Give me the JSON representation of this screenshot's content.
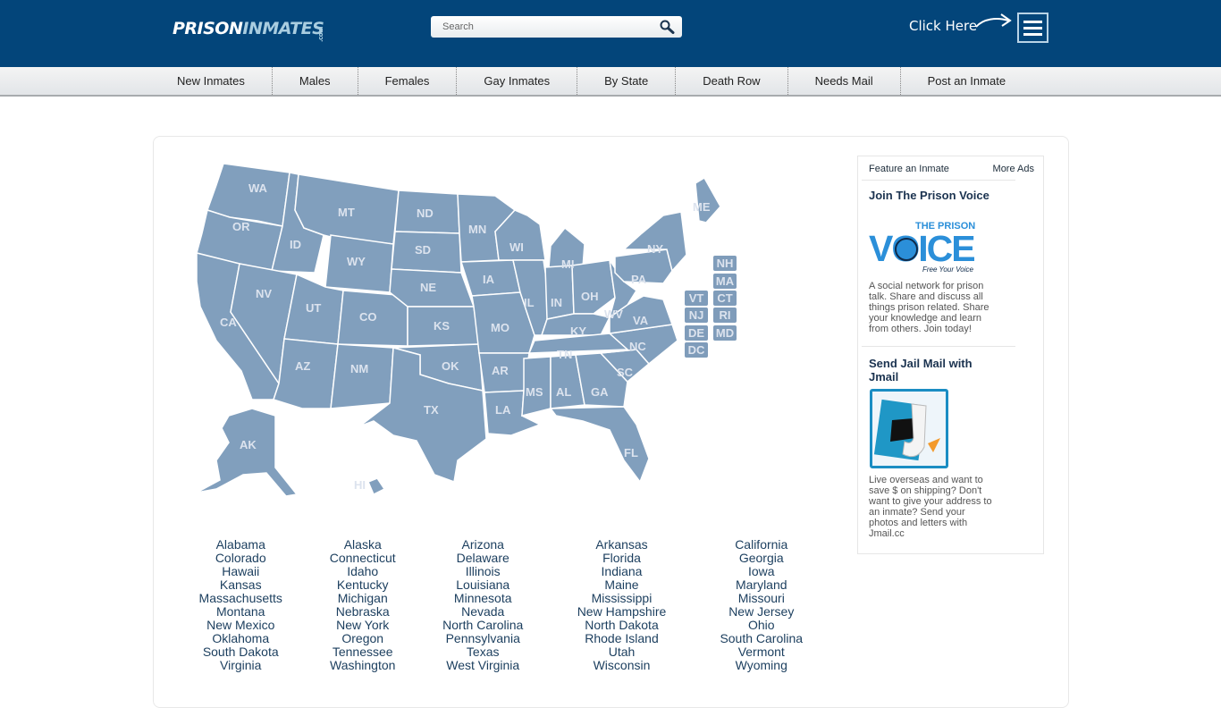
{
  "header": {
    "logo": {
      "part1": "PRISON",
      "part2": "INMATES",
      "suffix": ".com"
    },
    "search": {
      "placeholder": "Search",
      "value": "",
      "icon": "search-icon"
    },
    "click_here": "Click Here",
    "menu_icon": "hamburger-menu-icon"
  },
  "nav": {
    "items": [
      {
        "label": "New Inmates"
      },
      {
        "label": "Males"
      },
      {
        "label": "Females"
      },
      {
        "label": "Gay Inmates"
      },
      {
        "label": "By State"
      },
      {
        "label": "Death Row"
      },
      {
        "label": "Needs Mail"
      },
      {
        "label": "Post an Inmate"
      }
    ]
  },
  "map": {
    "states": [
      "WA",
      "OR",
      "CA",
      "ID",
      "NV",
      "MT",
      "WY",
      "UT",
      "AZ",
      "CO",
      "NM",
      "ND",
      "SD",
      "NE",
      "KS",
      "OK",
      "TX",
      "MN",
      "IA",
      "MO",
      "AR",
      "LA",
      "WI",
      "IL",
      "MI",
      "IN",
      "OH",
      "KY",
      "TN",
      "MS",
      "AL",
      "GA",
      "FL",
      "SC",
      "NC",
      "VA",
      "WV",
      "PA",
      "NY",
      "ME",
      "AK",
      "HI"
    ],
    "small_state_boxes": [
      "NH",
      "MA",
      "VT",
      "CT",
      "NJ",
      "RI",
      "DE",
      "MD",
      "DC"
    ],
    "fill_color": "#819fbd",
    "label_color": "#dce3ee"
  },
  "state_links": {
    "columns": [
      [
        "Alabama",
        "Colorado",
        "Hawaii",
        "Kansas",
        "Massachusetts",
        "Montana",
        "New Mexico",
        "Oklahoma",
        "South Dakota",
        "Virginia"
      ],
      [
        "Alaska",
        "Connecticut",
        "Idaho",
        "Kentucky",
        "Michigan",
        "Nebraska",
        "New York",
        "Oregon",
        "Tennessee",
        "Washington"
      ],
      [
        "Arizona",
        "Delaware",
        "Illinois",
        "Louisiana",
        "Minnesota",
        "Nevada",
        "North Carolina",
        "Pennsylvania",
        "Texas",
        "West Virginia"
      ],
      [
        "Arkansas",
        "Florida",
        "Indiana",
        "Maine",
        "Mississippi",
        "New Hampshire",
        "North Dakota",
        "Rhode Island",
        "Utah",
        "Wisconsin"
      ],
      [
        "California",
        "Georgia",
        "Iowa",
        "Maryland",
        "Missouri",
        "New Jersey",
        "Ohio",
        "South Carolina",
        "Vermont",
        "Wyoming"
      ]
    ]
  },
  "sidebar": {
    "feature_label": "Feature an Inmate",
    "more_ads_label": "More Ads",
    "ads": [
      {
        "title": "Join The Prison Voice",
        "logo_text_top": "THE PRISON",
        "logo_text_main": "VOICE",
        "logo_text_tag": "Free Your Voice",
        "text": "A social network for prison talk. Share and discuss all things prison related. Share your knowledge and learn from others. Join today!"
      },
      {
        "title": "Send Jail Mail with Jmail",
        "text": "Live overseas and want to save $ on shipping? Don't want to give your address to an inmate? Send your photos and letters with Jmail.cc"
      }
    ]
  }
}
